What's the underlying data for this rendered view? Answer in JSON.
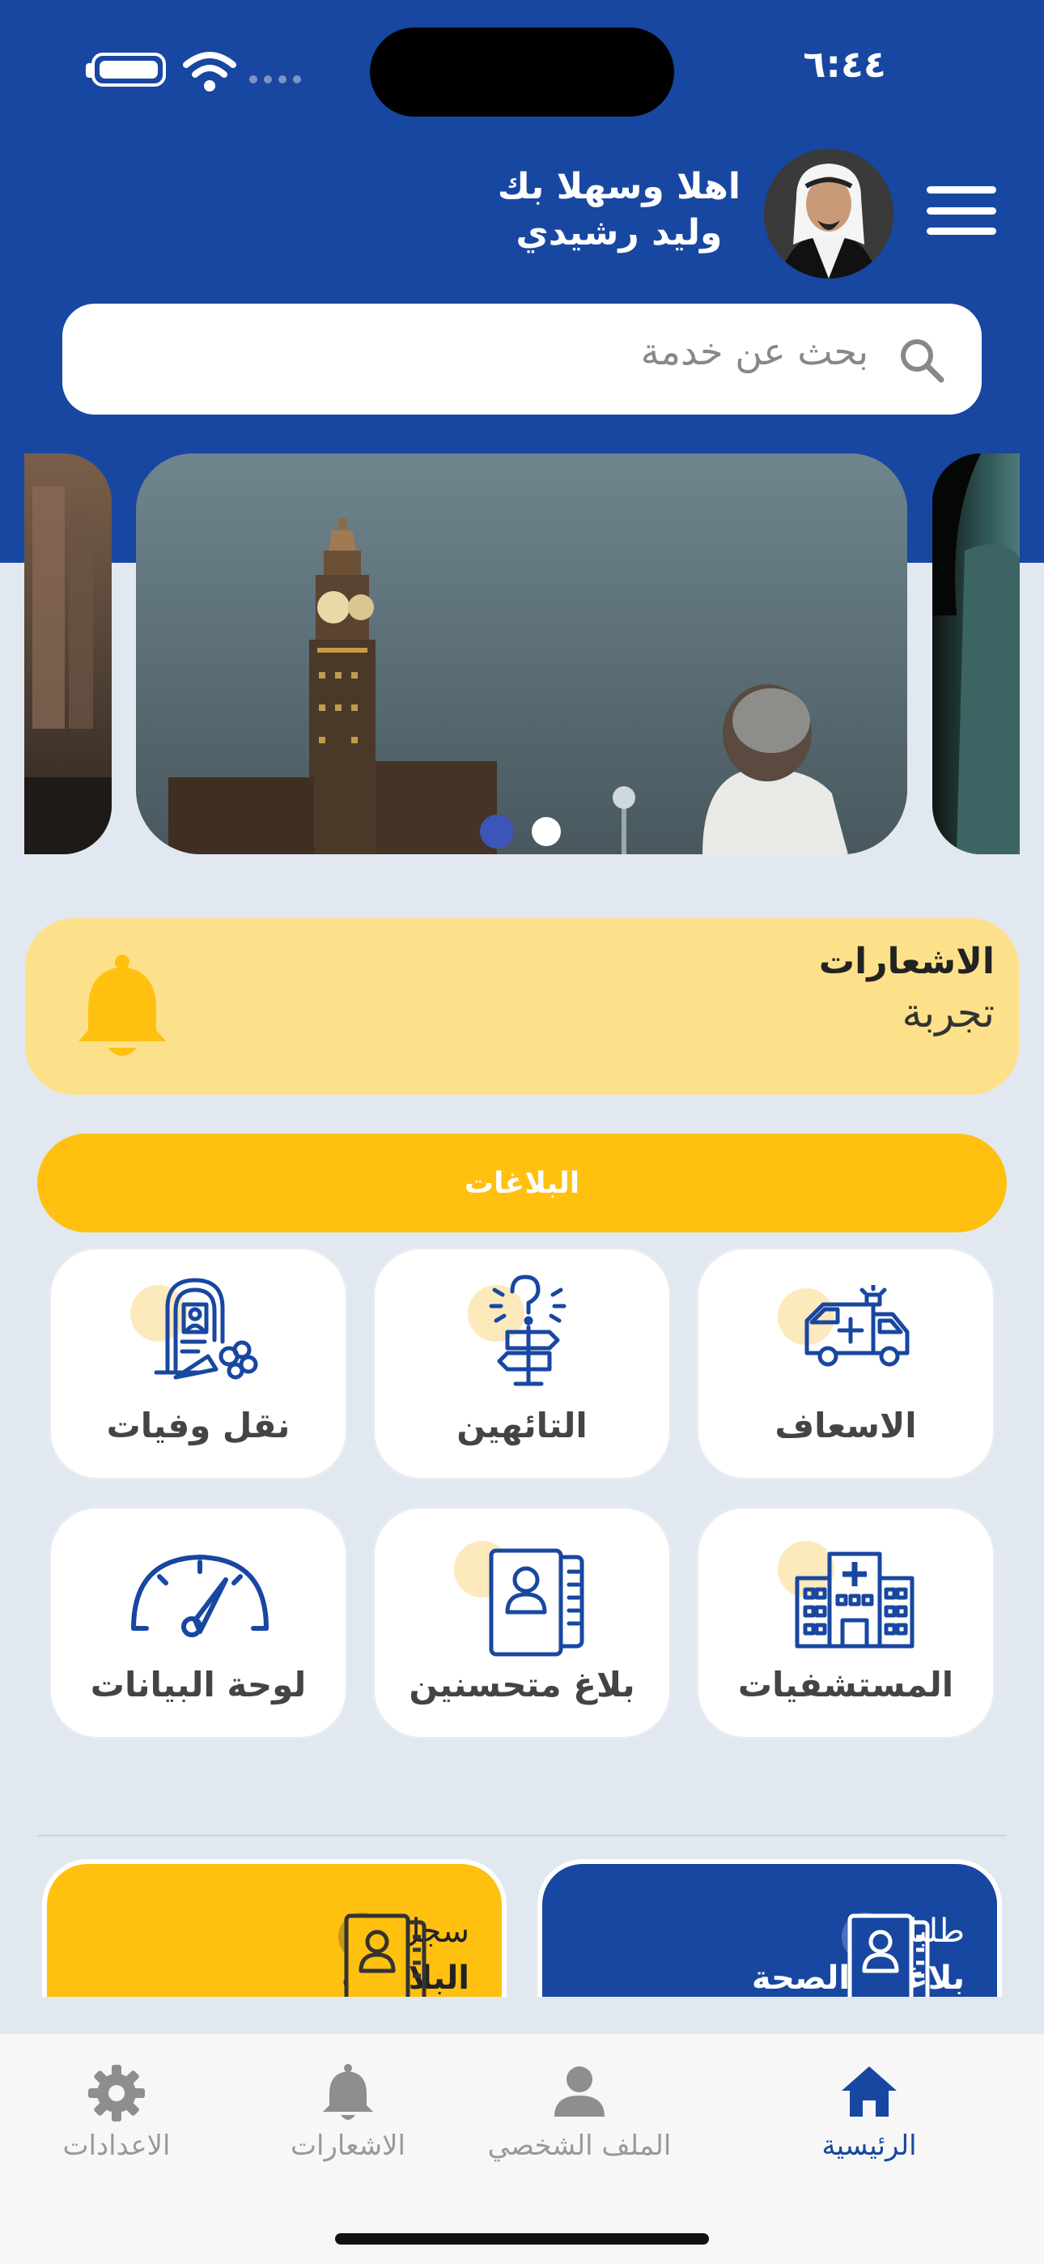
{
  "status_bar": {
    "time": "٦:٤٤"
  },
  "header": {
    "greeting": "اهلا وسهلا بك",
    "user_name": "وليد رشيدي"
  },
  "search": {
    "placeholder": "بحث عن خدمة"
  },
  "carousel": {
    "slides": 3,
    "active_index": 0
  },
  "notifications_card": {
    "title": "الاشعارات",
    "subtitle": "تجربة"
  },
  "reports_button": {
    "label": "البلاغات"
  },
  "services": [
    {
      "label": "الاسعاف",
      "icon": "ambulance-icon"
    },
    {
      "label": "التائهين",
      "icon": "signpost-question-icon"
    },
    {
      "label": "نقل وفيات",
      "icon": "grave-flowers-icon"
    },
    {
      "label": "المستشفيات",
      "icon": "hospital-icon"
    },
    {
      "label": "بلاغ متحسنين",
      "icon": "id-documents-icon"
    },
    {
      "label": "لوحة البيانات",
      "icon": "speedometer-icon"
    }
  ],
  "bottom_cards": [
    {
      "line1": "سجل",
      "line2": "البلاغات",
      "color": "#FFC010"
    },
    {
      "line1": "طلبات",
      "line2": "بلاغات الصحة",
      "color": "#1847A1"
    }
  ],
  "tabbar": {
    "items": [
      {
        "label": "الرئيسية",
        "icon": "home-icon",
        "active": true
      },
      {
        "label": "الملف الشخصي",
        "icon": "person-icon",
        "active": false
      },
      {
        "label": "الاشعارات",
        "icon": "bell-icon",
        "active": false
      },
      {
        "label": "الاعدادات",
        "icon": "gear-icon",
        "active": false
      }
    ]
  },
  "colors": {
    "primary": "#1847A1",
    "accent": "#FFC010",
    "notif_bg": "#FDE18A",
    "page_bg": "#E1E8F0"
  }
}
